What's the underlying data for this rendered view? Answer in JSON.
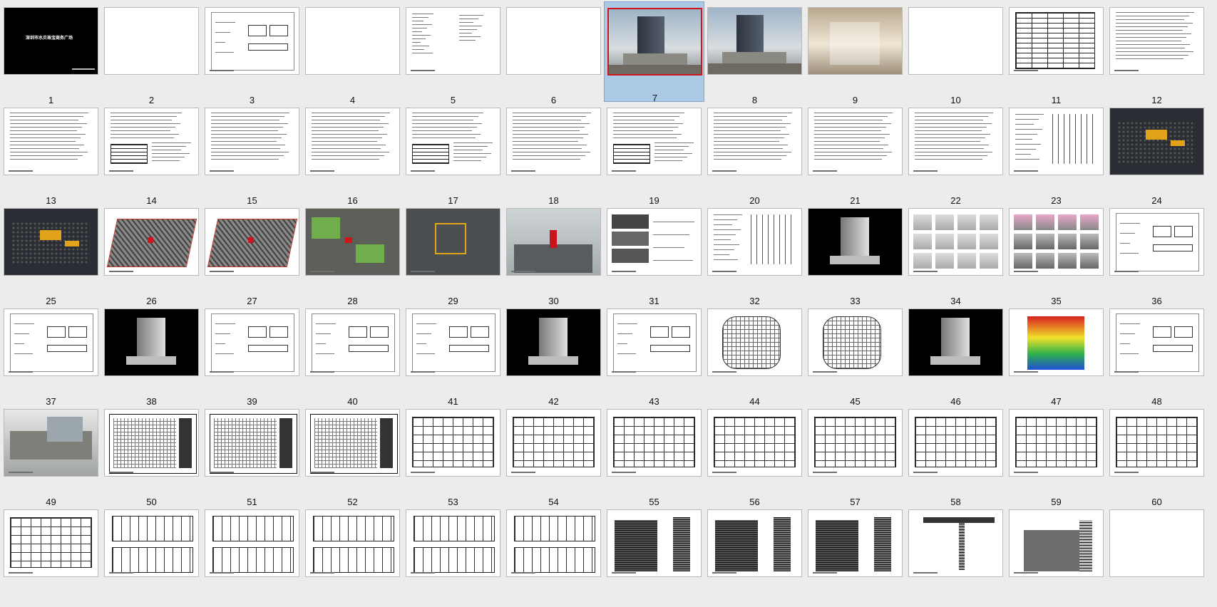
{
  "slides": [
    {
      "number": "1",
      "kind": "title-black",
      "title": "深圳市水贝珠宝商务广场"
    },
    {
      "number": "2",
      "kind": "blank"
    },
    {
      "number": "3",
      "kind": "diagram"
    },
    {
      "number": "4",
      "kind": "blank"
    },
    {
      "number": "5",
      "kind": "text-columns"
    },
    {
      "number": "6",
      "kind": "blank"
    },
    {
      "number": "7",
      "kind": "photo-tower",
      "selected": true
    },
    {
      "number": "8",
      "kind": "photo-tower"
    },
    {
      "number": "9",
      "kind": "photo-interior"
    },
    {
      "number": "10",
      "kind": "blank"
    },
    {
      "number": "11",
      "kind": "table"
    },
    {
      "number": "12",
      "kind": "text"
    },
    {
      "number": "13",
      "kind": "text"
    },
    {
      "number": "14",
      "kind": "text-table"
    },
    {
      "number": "15",
      "kind": "text"
    },
    {
      "number": "16",
      "kind": "text"
    },
    {
      "number": "17",
      "kind": "text-table"
    },
    {
      "number": "18",
      "kind": "text"
    },
    {
      "number": "19",
      "kind": "text-table"
    },
    {
      "number": "20",
      "kind": "text"
    },
    {
      "number": "21",
      "kind": "text"
    },
    {
      "number": "22",
      "kind": "text"
    },
    {
      "number": "23",
      "kind": "drawing"
    },
    {
      "number": "24",
      "kind": "map-dark"
    },
    {
      "number": "25",
      "kind": "map-dark"
    },
    {
      "number": "26",
      "kind": "plan-red"
    },
    {
      "number": "27",
      "kind": "plan-red"
    },
    {
      "number": "28",
      "kind": "map-green"
    },
    {
      "number": "29",
      "kind": "map-aerial"
    },
    {
      "number": "30",
      "kind": "photo-sky"
    },
    {
      "number": "31",
      "kind": "photos-list"
    },
    {
      "number": "32",
      "kind": "drawing"
    },
    {
      "number": "33",
      "kind": "model-black"
    },
    {
      "number": "34",
      "kind": "grid-models"
    },
    {
      "number": "35",
      "kind": "grid-models-pink"
    },
    {
      "number": "36",
      "kind": "diagram"
    },
    {
      "number": "37",
      "kind": "diagram"
    },
    {
      "number": "38",
      "kind": "model-black"
    },
    {
      "number": "39",
      "kind": "diagram"
    },
    {
      "number": "40",
      "kind": "diagram"
    },
    {
      "number": "41",
      "kind": "diagram"
    },
    {
      "number": "42",
      "kind": "model-black"
    },
    {
      "number": "43",
      "kind": "diagram"
    },
    {
      "number": "44",
      "kind": "site-plan"
    },
    {
      "number": "45",
      "kind": "site-plan"
    },
    {
      "number": "46",
      "kind": "model-black"
    },
    {
      "number": "47",
      "kind": "heatmap"
    },
    {
      "number": "48",
      "kind": "diagram"
    },
    {
      "number": "49",
      "kind": "photo-street"
    },
    {
      "number": "50",
      "kind": "cad"
    },
    {
      "number": "51",
      "kind": "cad"
    },
    {
      "number": "52",
      "kind": "cad"
    },
    {
      "number": "53",
      "kind": "floor"
    },
    {
      "number": "54",
      "kind": "floor"
    },
    {
      "number": "55",
      "kind": "floor"
    },
    {
      "number": "56",
      "kind": "floor"
    },
    {
      "number": "57",
      "kind": "floor"
    },
    {
      "number": "58",
      "kind": "floor"
    },
    {
      "number": "59",
      "kind": "floor"
    },
    {
      "number": "60",
      "kind": "floor"
    },
    {
      "number": "",
      "kind": "floor"
    },
    {
      "number": "",
      "kind": "floor-double"
    },
    {
      "number": "",
      "kind": "floor-double"
    },
    {
      "number": "",
      "kind": "floor-double"
    },
    {
      "number": "",
      "kind": "floor-double"
    },
    {
      "number": "",
      "kind": "floor-double"
    },
    {
      "number": "",
      "kind": "elevation"
    },
    {
      "number": "",
      "kind": "elevation"
    },
    {
      "number": "",
      "kind": "elevation"
    },
    {
      "number": "",
      "kind": "section"
    },
    {
      "number": "",
      "kind": "section-grey"
    },
    {
      "number": "",
      "kind": "blank"
    }
  ]
}
